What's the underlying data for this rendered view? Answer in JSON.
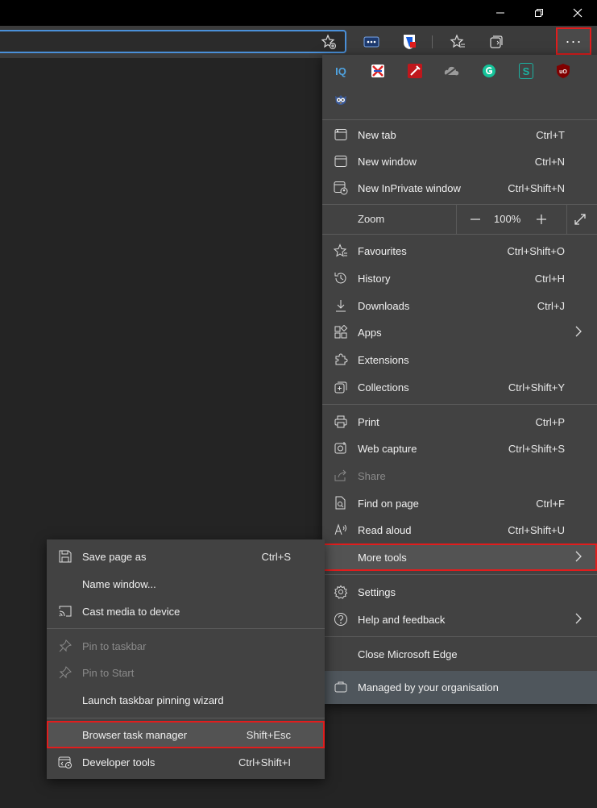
{
  "window": {
    "minimize_icon": "minimize-icon",
    "restore_icon": "restore-icon",
    "close_icon": "close-icon"
  },
  "toolbar": {
    "settings_more_label": "···"
  },
  "zoom": {
    "label": "Zoom",
    "value": "100%",
    "minus": "—",
    "plus": "+"
  },
  "extensions": [
    "IQ",
    "S",
    "uO"
  ],
  "menu": {
    "new_tab": {
      "label": "New tab",
      "shortcut": "Ctrl+T"
    },
    "new_window": {
      "label": "New window",
      "shortcut": "Ctrl+N"
    },
    "new_inprivate": {
      "label": "New InPrivate window",
      "shortcut": "Ctrl+Shift+N"
    },
    "favourites": {
      "label": "Favourites",
      "shortcut": "Ctrl+Shift+O"
    },
    "history": {
      "label": "History",
      "shortcut": "Ctrl+H"
    },
    "downloads": {
      "label": "Downloads",
      "shortcut": "Ctrl+J"
    },
    "apps": {
      "label": "Apps"
    },
    "extensions": {
      "label": "Extensions"
    },
    "collections": {
      "label": "Collections",
      "shortcut": "Ctrl+Shift+Y"
    },
    "print": {
      "label": "Print",
      "shortcut": "Ctrl+P"
    },
    "web_capture": {
      "label": "Web capture",
      "shortcut": "Ctrl+Shift+S"
    },
    "share": {
      "label": "Share"
    },
    "find": {
      "label": "Find on page",
      "shortcut": "Ctrl+F"
    },
    "read_aloud": {
      "label": "Read aloud",
      "shortcut": "Ctrl+Shift+U"
    },
    "more_tools": {
      "label": "More tools"
    },
    "settings": {
      "label": "Settings"
    },
    "help": {
      "label": "Help and feedback"
    },
    "close_edge": {
      "label": "Close Microsoft Edge"
    },
    "managed": {
      "label": "Managed by your organisation"
    }
  },
  "submenu": {
    "save_page": {
      "label": "Save page as",
      "shortcut": "Ctrl+S"
    },
    "name_window": {
      "label": "Name window..."
    },
    "cast": {
      "label": "Cast media to device"
    },
    "pin_taskbar": {
      "label": "Pin to taskbar"
    },
    "pin_start": {
      "label": "Pin to Start"
    },
    "pin_wizard": {
      "label": "Launch taskbar pinning wizard"
    },
    "task_manager": {
      "label": "Browser task manager",
      "shortcut": "Shift+Esc"
    },
    "dev_tools": {
      "label": "Developer tools",
      "shortcut": "Ctrl+Shift+I"
    }
  },
  "colors": {
    "highlight": "#e11d1d",
    "menu_bg": "#424242",
    "accent": "#4a90d9"
  }
}
